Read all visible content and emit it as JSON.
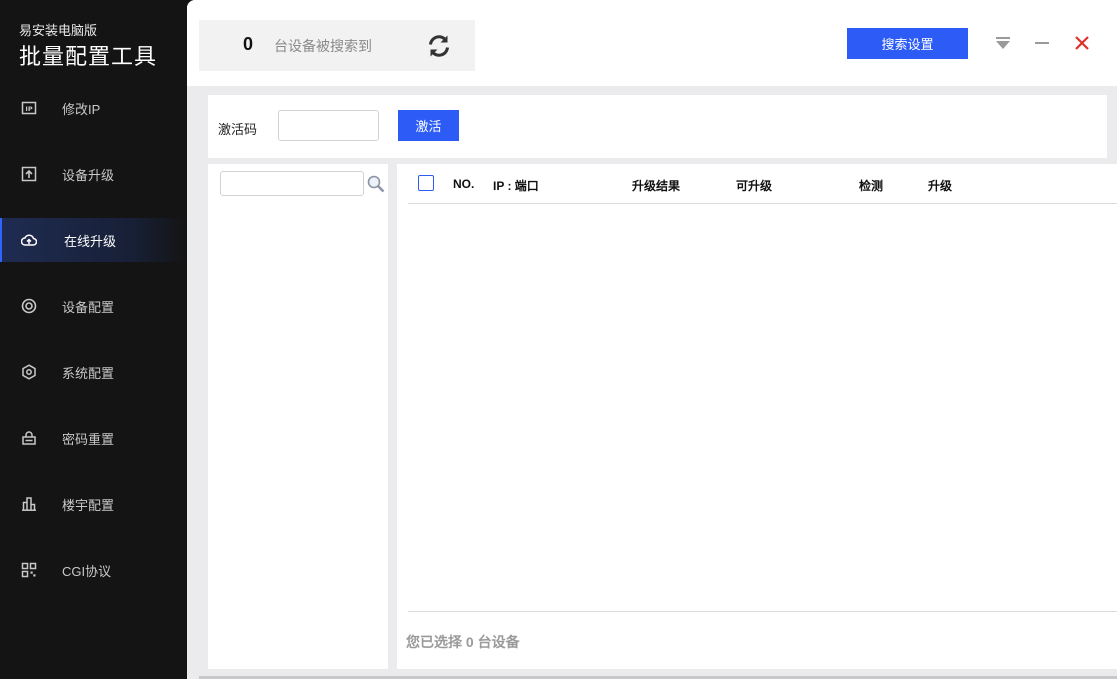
{
  "app": {
    "subtitle": "易安装电脑版",
    "title": "批量配置工具"
  },
  "sidebar": {
    "items": [
      {
        "label": "修改IP",
        "icon": "ip-icon",
        "active": false
      },
      {
        "label": "设备升级",
        "icon": "upload-box-icon",
        "active": false
      },
      {
        "label": "在线升级",
        "icon": "cloud-upload-icon",
        "active": true
      },
      {
        "label": "设备配置",
        "icon": "target-circle-icon",
        "active": false
      },
      {
        "label": "系统配置",
        "icon": "hexagon-gear-icon",
        "active": false
      },
      {
        "label": "密码重置",
        "icon": "lock-box-icon",
        "active": false
      },
      {
        "label": "楼宇配置",
        "icon": "building-icon",
        "active": false
      },
      {
        "label": "CGI协议",
        "icon": "grid-qr-icon",
        "active": false
      }
    ]
  },
  "header": {
    "device_count": "0",
    "device_count_text": "台设备被搜索到",
    "search_settings_label": "搜索设置"
  },
  "activation": {
    "label": "激活码",
    "input_value": "",
    "button_label": "激活"
  },
  "tree": {
    "search_value": ""
  },
  "table": {
    "columns": [
      "NO.",
      "IP : 端口",
      "升级结果",
      "可升级",
      "检测",
      "升级"
    ],
    "rows": []
  },
  "footer": {
    "selected_text": "您已选择 0 台设备"
  },
  "colors": {
    "accent": "#2c5bf6",
    "sidebar_bg": "#141414",
    "close": "#e0302a"
  }
}
